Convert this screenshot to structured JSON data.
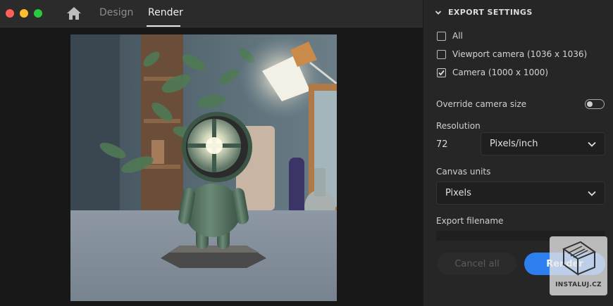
{
  "tabs": [
    {
      "label": "Design",
      "active": false
    },
    {
      "label": "Render",
      "active": true
    }
  ],
  "export_settings": {
    "title": "EXPORT SETTINGS",
    "options": [
      {
        "label": "All",
        "checked": false
      },
      {
        "label": "Viewport camera (1036 x 1036)",
        "checked": false
      },
      {
        "label": "Camera (1000 x 1000)",
        "checked": true
      }
    ],
    "override_label": "Override camera size",
    "override_on": false,
    "resolution_label": "Resolution",
    "resolution_value": "72",
    "resolution_unit": "Pixels/inch",
    "canvas_units_label": "Canvas units",
    "canvas_units_value": "Pixels",
    "filename_label": "Export filename",
    "cancel_label": "Cancel all",
    "render_label": "Render"
  },
  "watermark": {
    "text": "INSTALUJ.CZ"
  },
  "icons": [
    "home-icon",
    "chevron-down-icon",
    "checkmark-icon",
    "dropdown-chevron-icon"
  ],
  "colors": {
    "accent": "#2d7ff0",
    "panel": "#262626",
    "titlebar": "#2b2b2b"
  }
}
